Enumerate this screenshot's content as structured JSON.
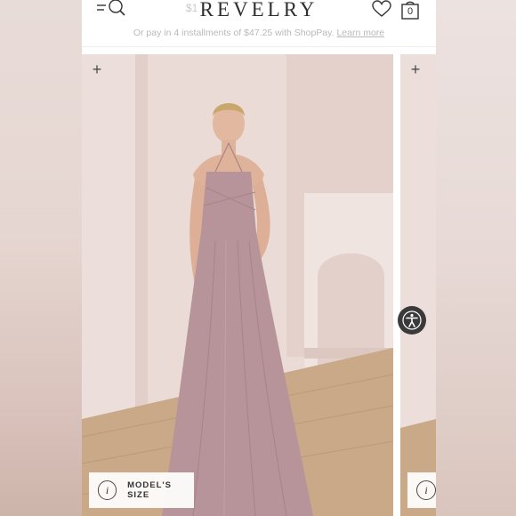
{
  "header": {
    "brand": "REVELRY",
    "price_partial": "$1",
    "cart_count": "0"
  },
  "promo": {
    "text": "Or pay in 4 installments of $47.25 with ShopPay.",
    "link": "Learn more"
  },
  "gallery": {
    "model_size_label": "MODEL'S SIZE",
    "info_glyph": "i",
    "zoom_glyph": "+"
  },
  "icons": {
    "menu_search": "menu-search-icon",
    "wishlist": "heart-icon",
    "cart": "shopping-bag-icon",
    "zoom": "plus-icon",
    "info": "info-icon",
    "accessibility": "accessibility-icon"
  },
  "colors": {
    "dress": "#b7939a",
    "background_wall": "#eadbd6",
    "floor": "#c9a988",
    "text": "#2f2f2f",
    "muted": "#b9b9b9"
  }
}
